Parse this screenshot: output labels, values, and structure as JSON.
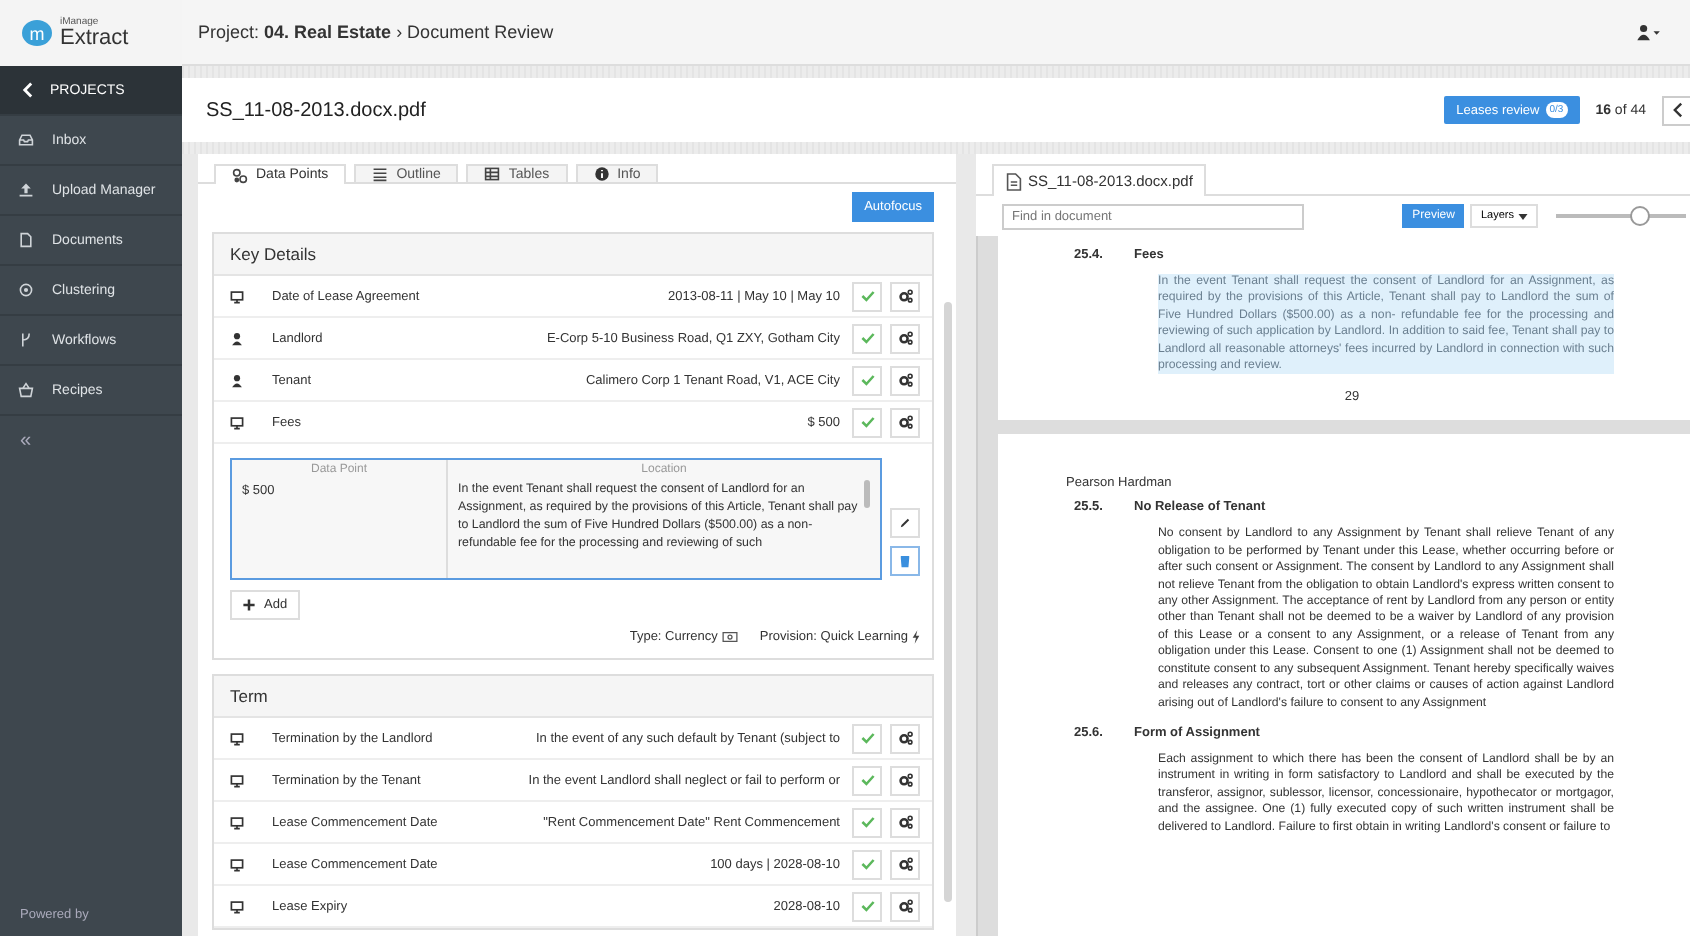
{
  "logo": {
    "mark": "m",
    "brand": "iManage",
    "product": "Extract"
  },
  "sidebar": {
    "back": "PROJECTS",
    "items": [
      {
        "label": "Inbox"
      },
      {
        "label": "Upload Manager"
      },
      {
        "label": "Documents"
      },
      {
        "label": "Clustering"
      },
      {
        "label": "Workflows"
      },
      {
        "label": "Recipes"
      }
    ],
    "collapse": "«",
    "footer": "Powered by"
  },
  "topbar": {
    "breadcrumb": "Project: **04. Real Estate** › Document Review"
  },
  "document_header": {
    "filename": "SS_11-08-2013.docx.pdf",
    "review_button": "Leases review",
    "review_badge": "0/3",
    "counter": "**16** of 44"
  },
  "left_panel": {
    "tabs": [
      {
        "label": "Data Points",
        "selected": true
      },
      {
        "label": "Outline",
        "selected": false
      },
      {
        "label": "Tables",
        "selected": false
      },
      {
        "label": "Info",
        "selected": false
      }
    ],
    "autofocus": "Autofocus",
    "sections": [
      {
        "title": "Key Details",
        "rows": [
          {
            "kind": "monitor",
            "label": "Date of Lease Agreement",
            "value": "2013-08-11 | May 10 | May 10"
          },
          {
            "kind": "person",
            "label": "Landlord",
            "value": "E-Corp 5-10 Business Road, Q1 ZXY, Gotham City"
          },
          {
            "kind": "person",
            "label": "Tenant",
            "value": "Calimero Corp 1 Tenant Road, V1, ACE City"
          },
          {
            "kind": "monitor",
            "label": "Fees",
            "value": "$ 500"
          }
        ],
        "detail": {
          "columns": [
            "Data Point",
            "Location"
          ],
          "value": "$ 500",
          "location": "In the event Tenant shall request the consent of Landlord for an Assignment, as required by the provisions of this Article, Tenant shall pay to Landlord the sum of Five Hundred Dollars ($500.00) as a non- refundable fee for the processing and reviewing of such",
          "add": "Add",
          "type": "Type: Currency",
          "provision": "Provision: Quick Learning"
        }
      },
      {
        "title": "Term",
        "rows": [
          {
            "kind": "monitor",
            "label": "Termination by the Landlord",
            "value": "In the event of any such default by Tenant (subject to"
          },
          {
            "kind": "monitor",
            "label": "Termination by the Tenant",
            "value": "In the event Landlord shall neglect or fail to perform or"
          },
          {
            "kind": "monitor",
            "label": "Lease Commencement Date",
            "value": "\"Rent Commencement Date\" Rent Commencement"
          },
          {
            "kind": "monitor",
            "label": "Lease Commencement Date",
            "value": "100 days | 2028-08-10"
          },
          {
            "kind": "monitor",
            "label": "Lease Expiry",
            "value": "2028-08-10"
          }
        ]
      }
    ]
  },
  "right_panel": {
    "tab": "SS_11-08-2013.docx.pdf",
    "search": {
      "placeholder": "Find in document"
    },
    "preview": {
      "label": "Preview",
      "selected": true
    },
    "layers": "Layers",
    "zoom": {
      "level": 0.65
    },
    "pages": [
      {
        "blocks": [
          {
            "kind": "heading",
            "number": "25.4.",
            "title": "Fees"
          },
          {
            "kind": "paragraph",
            "highlighted": true,
            "text": "In the event Tenant shall request the consent of Landlord for an Assignment, as required by the provisions of this Article, Tenant shall pay to Landlord the sum of Five Hundred Dollars ($500.00) as a non- refundable fee for the processing and reviewing of such application by Landlord. In addition to said fee, Tenant shall pay to Landlord all reasonable attorneys' fees incurred by Landlord in connection with such processing and review."
          },
          {
            "kind": "page_number",
            "text": "29"
          }
        ]
      },
      {
        "blocks": [
          {
            "kind": "running_header",
            "text": "Pearson Hardman"
          },
          {
            "kind": "heading",
            "number": "25.5.",
            "title": "No Release of Tenant"
          },
          {
            "kind": "paragraph",
            "highlighted": false,
            "text": "No consent by Landlord to any Assignment by Tenant shall relieve Tenant of any obligation to be performed by Tenant under this Lease, whether occurring before or after such consent or Assignment. The consent by Landlord to any Assignment shall not relieve Tenant from the obligation to obtain Landlord's express written consent to any other Assignment. The acceptance of rent by Landlord from any person or entity other than Tenant shall not be deemed to be a waiver by Landlord of any provision of this Lease or a consent to any Assignment, or a release of Tenant from any obligation under this Lease. Consent to one (1) Assignment shall not be deemed to constitute consent to any subsequent Assignment. Tenant hereby specifically waives and releases any contract, tort or other claims or causes of action against Landlord arising out of Landlord's failure to consent to any Assignment"
          },
          {
            "kind": "heading",
            "number": "25.6.",
            "title": "Form of Assignment"
          },
          {
            "kind": "paragraph",
            "highlighted": false,
            "text": "Each assignment to which there has been the consent of Landlord shall be by an instrument in writing in form satisfactory to Landlord and shall be executed by the transferor, assignor, sublessor, licensor, concessionaire, hypothecator or mortgagor, and the assignee.  One (1) fully executed copy of such written instrument shall be delivered to Landlord. Failure to first obtain in writing  Landlord's consent or failure to"
          }
        ]
      }
    ]
  }
}
